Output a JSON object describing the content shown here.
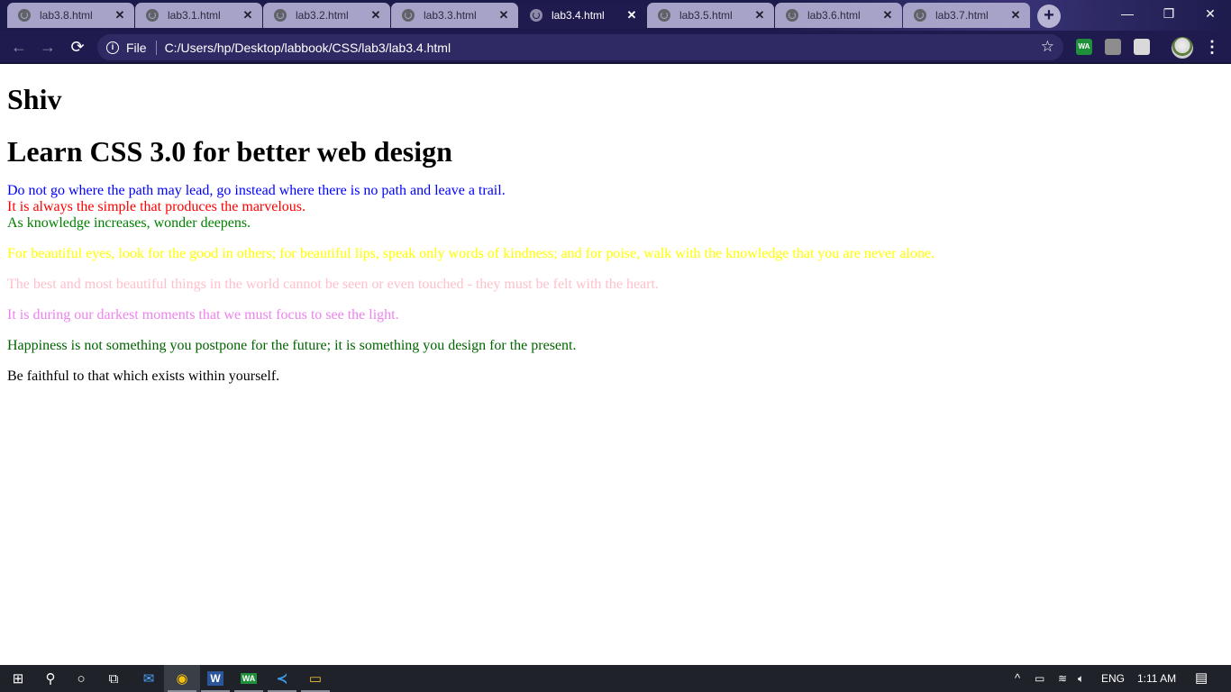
{
  "browser": {
    "tabs": [
      {
        "title": "lab3.8.html",
        "active": false
      },
      {
        "title": "lab3.1.html",
        "active": false
      },
      {
        "title": "lab3.2.html",
        "active": false
      },
      {
        "title": "lab3.3.html",
        "active": false
      },
      {
        "title": "lab3.4.html",
        "active": true
      },
      {
        "title": "lab3.5.html",
        "active": false
      },
      {
        "title": "lab3.6.html",
        "active": false
      },
      {
        "title": "lab3.7.html",
        "active": false
      }
    ],
    "new_tab_symbol": "+",
    "window_controls": {
      "minimize": "—",
      "restore": "❐",
      "close": "✕"
    },
    "toolbar": {
      "back_symbol": "←",
      "forward_symbol": "→",
      "reload_symbol": "⟳",
      "info_symbol": "i",
      "scheme_label": "File",
      "url": "C:/Users/hp/Desktop/labbook/CSS/lab3/lab3.4.html",
      "star_symbol": "☆",
      "menu_symbol": "⋮"
    },
    "extensions": [
      {
        "name": "whatsapp-extension-icon",
        "label": "WA",
        "color": "#1f8f3a"
      },
      {
        "name": "evernote-extension-icon",
        "label": "",
        "color": "#8d8d8d"
      },
      {
        "name": "cast-extension-icon",
        "label": "",
        "color": "#d9d9d9"
      }
    ]
  },
  "page": {
    "heading1": "Shiv",
    "heading2": "Learn CSS 3.0 for better web design",
    "lines": [
      {
        "text": "Do not go where the path may lead, go instead where there is no path and leave a trail.",
        "color": "#0000ff"
      },
      {
        "text": "It is always the simple that produces the marvelous.",
        "color": "#ff0000"
      },
      {
        "text": "As knowledge increases, wonder deepens.",
        "color": "#008000"
      }
    ],
    "paragraphs": [
      {
        "text": "For beautiful eyes, look for the good in others; for beautiful lips, speak only words of kindness; and for poise, walk with the knowledge that you are never alone.",
        "color": "#ffff00"
      },
      {
        "text": "The best and most beautiful things in the world cannot be seen or even touched - they must be felt with the heart.",
        "color": "#ffc0cb"
      },
      {
        "text": "It is during our darkest moments that we must focus to see the light.",
        "color": "#ee82ee"
      },
      {
        "text": "Happiness is not something you postpone for the future; it is something you design for the present.",
        "color": "#006400"
      },
      {
        "text": "Be faithful to that which exists within yourself.",
        "color": "#000000"
      }
    ]
  },
  "taskbar": {
    "apps": [
      {
        "name": "start-button",
        "glyph": "⊞"
      },
      {
        "name": "search-button",
        "glyph": "⚲"
      },
      {
        "name": "cortana-button",
        "glyph": "○"
      },
      {
        "name": "task-view-button",
        "glyph": "⧉"
      },
      {
        "name": "mail-app",
        "glyph": "✉"
      },
      {
        "name": "chrome-app",
        "glyph": "◉"
      },
      {
        "name": "word-app",
        "glyph": "W"
      },
      {
        "name": "whatsapp-app",
        "glyph": "WA"
      },
      {
        "name": "vscode-app",
        "glyph": "≺"
      },
      {
        "name": "file-explorer-app",
        "glyph": "▭"
      }
    ],
    "tray": {
      "chevron": "^",
      "language": "ENG",
      "time": "1:11 AM",
      "notification_symbol": "▤"
    }
  }
}
